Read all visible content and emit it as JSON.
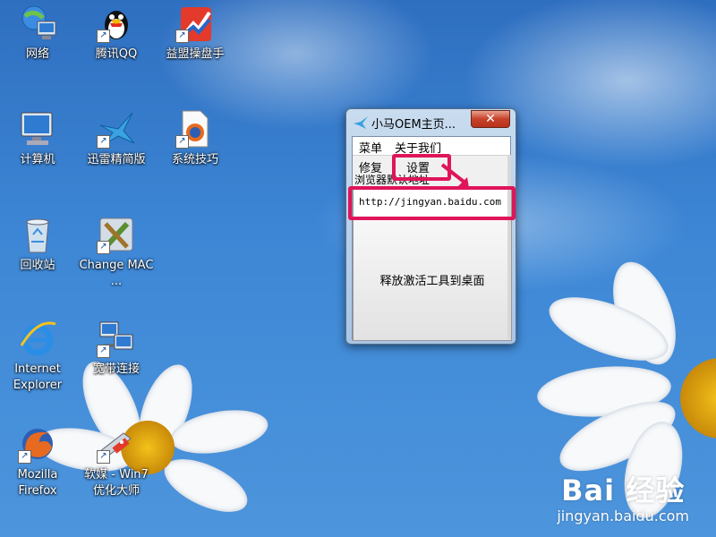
{
  "desktop": {
    "icons": [
      {
        "label": "网络",
        "icon": "network-icon"
      },
      {
        "label": "腾讯QQ",
        "icon": "qq-penguin-icon"
      },
      {
        "label": "益盟操盘手",
        "icon": "stock-app-icon"
      },
      {
        "label": "计算机",
        "icon": "computer-icon"
      },
      {
        "label": "迅雷精简版",
        "icon": "thunder-bird-icon"
      },
      {
        "label": "系统技巧",
        "icon": "firefox-doc-icon"
      },
      {
        "label": "回收站",
        "icon": "recycle-bin-icon"
      },
      {
        "label": "Change MAC ...",
        "icon": "tools-icon"
      },
      {
        "label": "Internet Explorer",
        "icon": "ie-icon"
      },
      {
        "label": "宽带连接",
        "icon": "broadband-icon"
      },
      {
        "label": "Mozilla Firefox",
        "icon": "firefox-icon"
      },
      {
        "label": "软媒 - Win7 优化大师",
        "icon": "knife-icon"
      }
    ]
  },
  "window": {
    "title": "小马OEM主页...",
    "close_label": "✕",
    "menu": [
      "菜单",
      "关于我们"
    ],
    "tabs": [
      "修复",
      "设置"
    ],
    "group_label": "浏览器默认地址",
    "url_value": "http://jingyan.baidu.com",
    "release_button": "释放激活工具到桌面"
  },
  "watermark": {
    "logo": "Bai 经验",
    "url": "jingyan.baidu.com"
  },
  "colors": {
    "annotation": "#e0145a",
    "sky": "#3d87d6"
  }
}
